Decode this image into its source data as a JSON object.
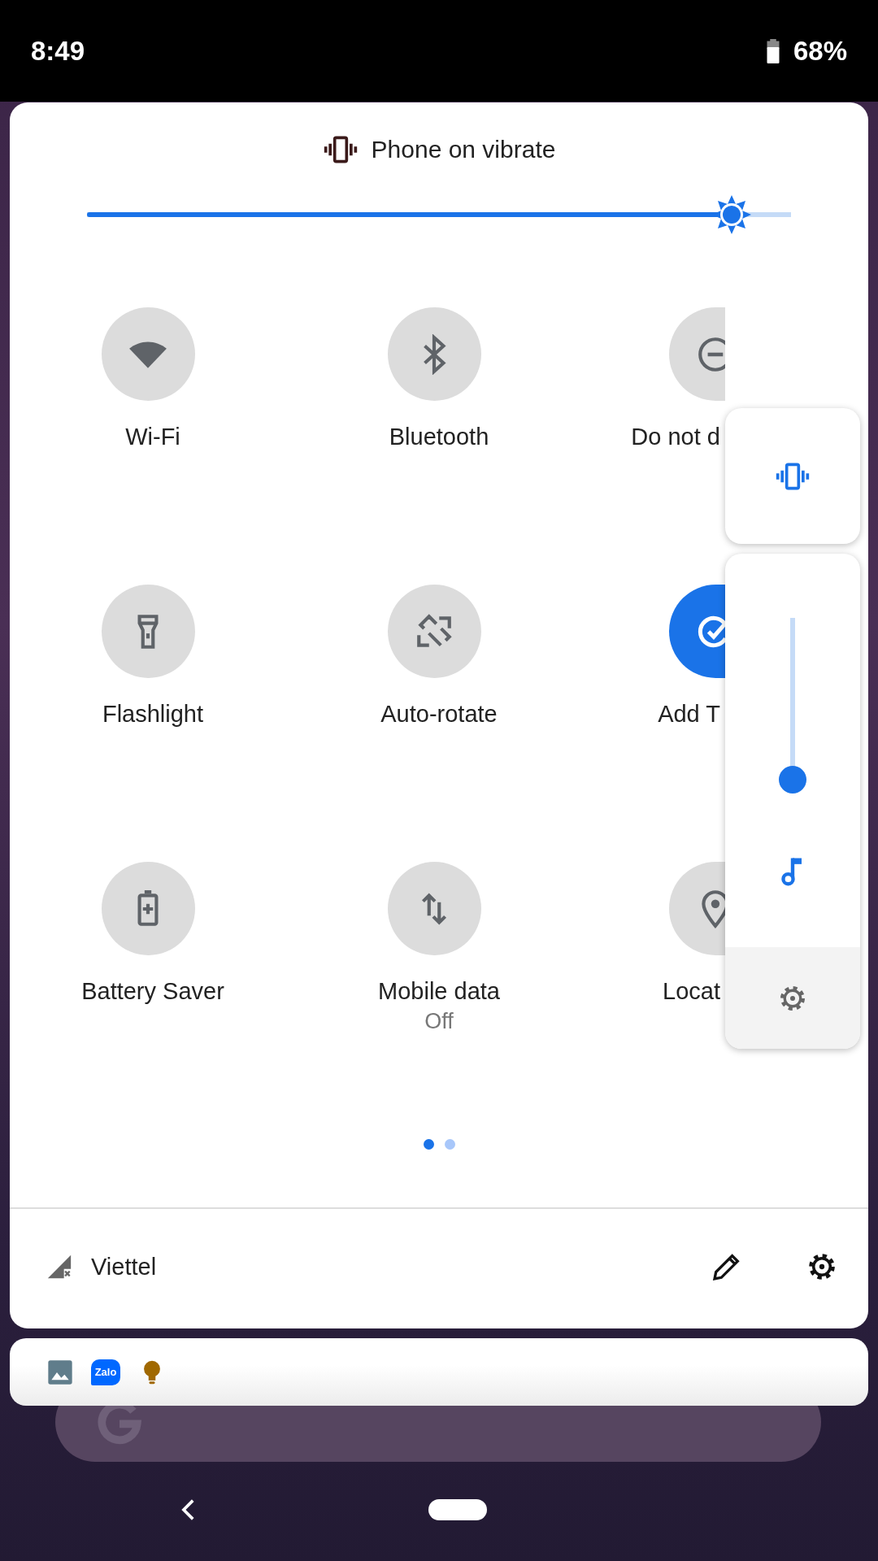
{
  "status_bar": {
    "time": "8:49",
    "battery": "68%"
  },
  "quick_settings": {
    "ringer": {
      "label": "Phone on vibrate"
    },
    "brightness": {
      "level": 0.94
    },
    "tiles": [
      {
        "kind": "wifi",
        "label": "Wi-Fi",
        "on": false
      },
      {
        "kind": "bluetooth",
        "label": "Bluetooth",
        "on": false
      },
      {
        "kind": "dnd",
        "label": "Do not d",
        "on": false
      },
      {
        "kind": "flashlight",
        "label": "Flashlight",
        "on": false
      },
      {
        "kind": "rotate",
        "label": "Auto-rotate",
        "on": false
      },
      {
        "kind": "add_tile",
        "label": "Add T",
        "on": true
      },
      {
        "kind": "battery_saver",
        "label": "Battery Saver",
        "on": false
      },
      {
        "kind": "mobile_data",
        "label": "Mobile data",
        "sublabel": "Off",
        "on": false
      },
      {
        "kind": "location",
        "label": "Locat",
        "on": false
      }
    ],
    "pages": [
      {
        "selected": true
      },
      {
        "selected": false
      }
    ],
    "carrier": "Viettel"
  },
  "notifications": {
    "apps": [
      {
        "kind": "gallery"
      },
      {
        "kind": "zalo",
        "label": "Zalo"
      },
      {
        "kind": "bulb"
      }
    ]
  },
  "volume_panel": {
    "level": 0
  }
}
